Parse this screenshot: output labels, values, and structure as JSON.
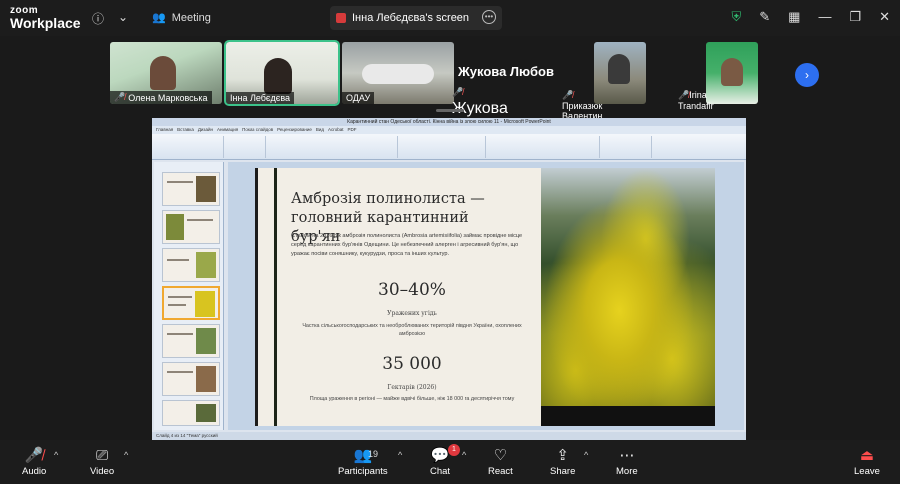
{
  "app": {
    "brand_top": "zoom",
    "brand_bottom": "Workplace"
  },
  "topbar": {
    "meeting_label": "Meeting",
    "screen_tab_label": "Інна Лебєдєва's screen"
  },
  "participants_strip": [
    {
      "name": "Олена Марковська",
      "muted": true
    },
    {
      "name": "Інна Лебєдєва",
      "muted": false,
      "active": true
    },
    {
      "name": "ОДАУ",
      "muted": false
    },
    {
      "name": "Жукова Любов",
      "muted": true
    },
    {
      "name": "Приказюк Валентин В...",
      "muted": true
    },
    {
      "name": "Irina Trandafir",
      "muted": true
    }
  ],
  "highlight_name": "Жукова Любов",
  "powerpoint": {
    "window_title": "Карантинний стан Одеської області. Кінна війна із злою силою 11 - Microsoft PowerPoint",
    "ribbon_tabs": [
      "Главная",
      "Вставка",
      "Дизайн",
      "Анимация",
      "Показ слайдов",
      "Рецензирование",
      "Вид",
      "Acrobat",
      "PDF"
    ],
    "status_text": "Слайд 4 из 14   \"Тема\"   русский"
  },
  "slide": {
    "title": "Амброзія полинолиста — головний карантинний бур'ян",
    "body": "Станом на 2026 рік амброзія полинолиста (Ambrosia artemisiifolia) займає провідне місце серед карантинних бур'янів Одещини. Це небезпечний алерген і агресивний бур'ян, що уражає посіви соняшнику, кукурудзи, проса та інших культур.",
    "stat1_value": "30–40%",
    "stat1_label": "Уражених угідь",
    "stat1_note": "Частка сільськогосподарських та необроблюваних територій півдня України, охоплених амброзією",
    "stat2_value": "35 000",
    "stat2_label": "Гектарів (2026)",
    "stat2_note": "Площа ураження в регіоні — майже вдвічі більше, ніж 18 000 га десятиріччя тому"
  },
  "toolbar": {
    "audio": "Audio",
    "video": "Video",
    "participants": "Participants",
    "participants_count": "19",
    "chat": "Chat",
    "chat_badge": "1",
    "react": "React",
    "share": "Share",
    "more": "More",
    "leave": "Leave"
  }
}
